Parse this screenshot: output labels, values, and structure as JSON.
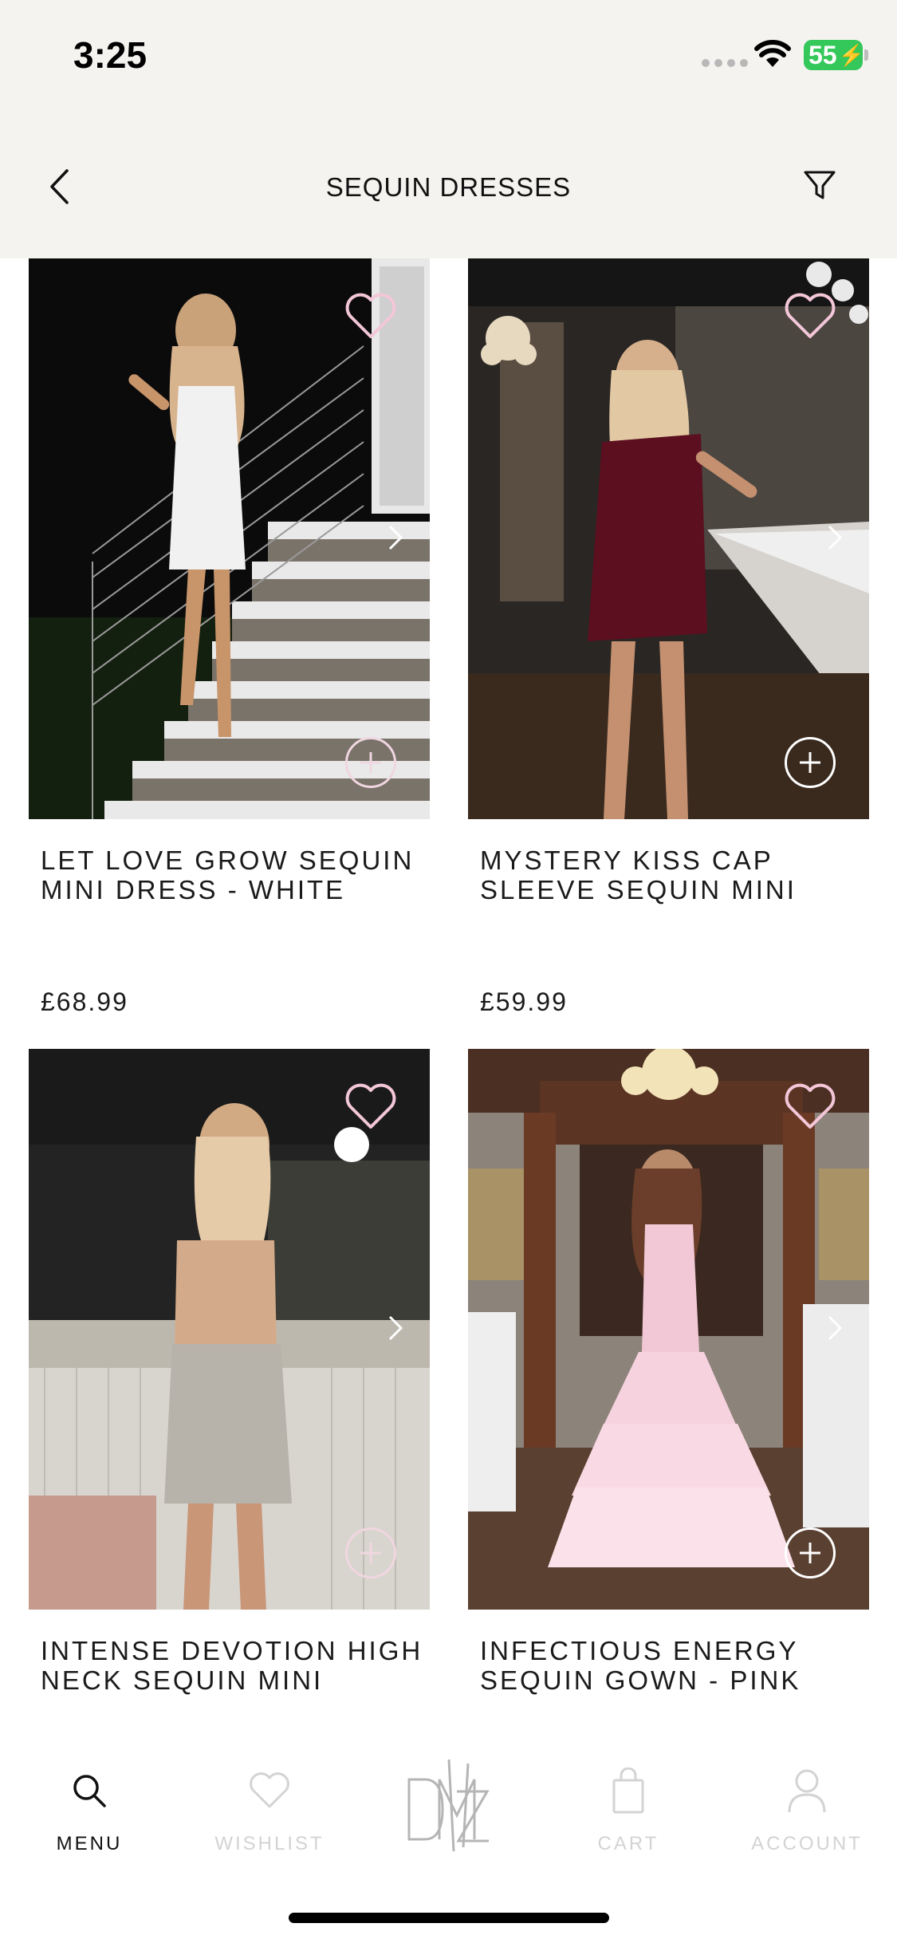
{
  "status_bar": {
    "time": "3:25",
    "battery": "55"
  },
  "header": {
    "title": "SEQUIN DRESSES",
    "back_icon": "chevron-left-icon",
    "filter_icon": "filter-icon"
  },
  "products": [
    {
      "name": "LET LOVE GROW SEQUIN MINI DRESS - WHITE",
      "price": "£68.99"
    },
    {
      "name": "MYSTERY KISS CAP SLEEVE SEQUIN MINI",
      "price": "£59.99"
    },
    {
      "name": "INTENSE DEVOTION HIGH NECK SEQUIN MINI",
      "price": ""
    },
    {
      "name": "INFECTIOUS ENERGY SEQUIN GOWN - PINK",
      "price": ""
    }
  ],
  "tabbar": {
    "items": [
      {
        "label": "MENU",
        "icon": "search-icon",
        "active": true
      },
      {
        "label": "WISHLIST",
        "icon": "heart-icon",
        "active": false
      },
      {
        "label": "",
        "icon": "brand-logo",
        "active": false
      },
      {
        "label": "CART",
        "icon": "shopping-bag-icon",
        "active": false
      },
      {
        "label": "ACCOUNT",
        "icon": "user-icon",
        "active": false
      }
    ]
  },
  "colors": {
    "header_bg": "#f4f3f0",
    "heart_pink": "#f3c6d8",
    "inactive_tab": "#d3d3d3"
  }
}
